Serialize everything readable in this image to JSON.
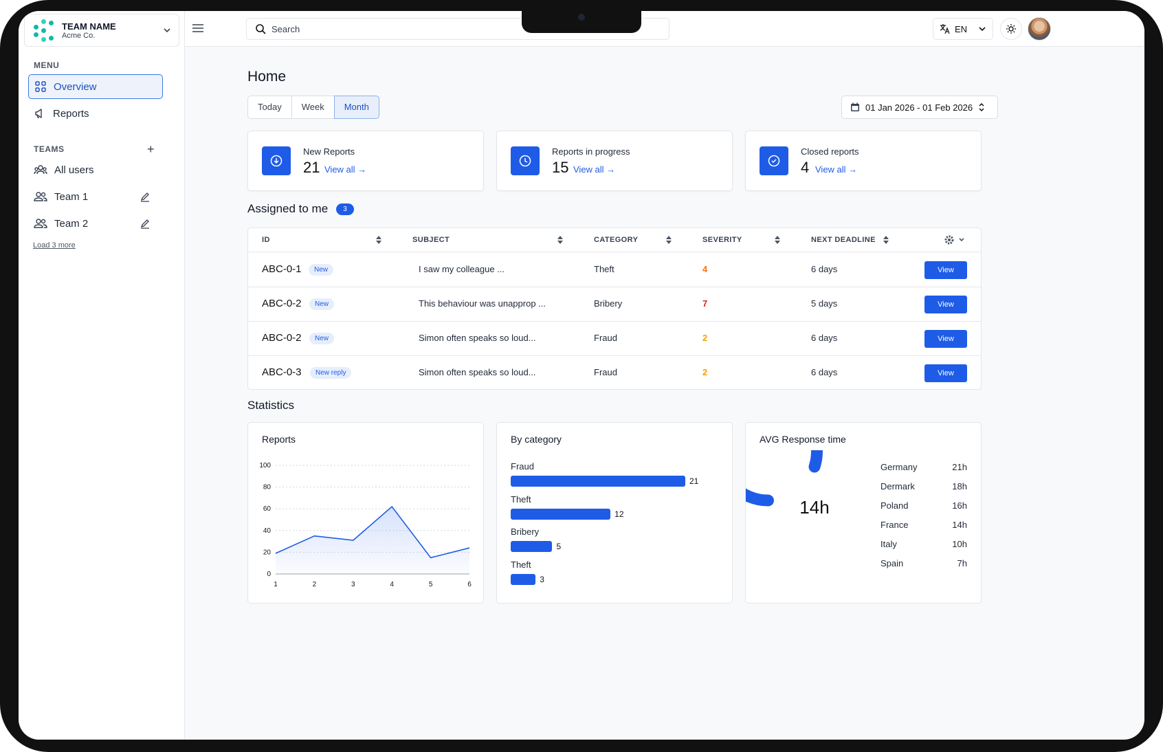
{
  "team": {
    "name": "TEAM NAME",
    "org": "Acme Co."
  },
  "sidebar": {
    "menu_label": "MENU",
    "menu_items": [
      {
        "label": "Overview",
        "icon": "grid-icon",
        "active": true
      },
      {
        "label": "Reports",
        "icon": "megaphone-icon",
        "active": false
      }
    ],
    "teams_label": "TEAMS",
    "team_items": [
      {
        "label": "All users"
      },
      {
        "label": "Team 1"
      },
      {
        "label": "Team 2"
      }
    ],
    "load_more": "Load 3 more"
  },
  "topbar": {
    "search_placeholder": "Search",
    "language": "EN"
  },
  "page": {
    "title": "Home",
    "periods": [
      "Today",
      "Week",
      "Month"
    ],
    "active_period": "Month",
    "date_range": "01 Jan 2026 - 01 Feb 2026"
  },
  "kpis": [
    {
      "label": "New Reports",
      "value": "21",
      "link": "View all →",
      "icon": "arrow-down-circle-icon"
    },
    {
      "label": "Reports in progress",
      "value": "15",
      "link": "View all →",
      "icon": "clock-icon"
    },
    {
      "label": "Closed reports",
      "value": "4",
      "link": "View all →",
      "icon": "check-circle-icon"
    }
  ],
  "assigned": {
    "title": "Assigned to me",
    "count": "3",
    "columns": [
      "ID",
      "SUBJECT",
      "CATEGORY",
      "SEVERITY",
      "NEXT DEADLINE"
    ],
    "view_label": "View",
    "rows": [
      {
        "id": "ABC-0-1",
        "tag": "New",
        "subject": "I saw my colleague ...",
        "category": "Theft",
        "severity": "4",
        "severity_color": "#f97316",
        "deadline": "6 days"
      },
      {
        "id": "ABC-0-2",
        "tag": "New",
        "subject": "This behaviour was unapprop ...",
        "category": "Bribery",
        "severity": "7",
        "severity_color": "#dc2626",
        "deadline": "5 days"
      },
      {
        "id": "ABC-0-2",
        "tag": "New",
        "subject": "Simon often speaks so loud...",
        "category": "Fraud",
        "severity": "2",
        "severity_color": "#f59e0b",
        "deadline": "6 days"
      },
      {
        "id": "ABC-0-3",
        "tag": "New reply",
        "subject": "Simon often speaks so loud...",
        "category": "Fraud",
        "severity": "2",
        "severity_color": "#f59e0b",
        "deadline": "6 days"
      }
    ]
  },
  "statistics": {
    "title": "Statistics",
    "reports_title": "Reports",
    "category_title": "By category",
    "avg_title": "AVG Response time",
    "avg_center": "14h",
    "avg_rows": [
      {
        "country": "Germany",
        "value": "21h"
      },
      {
        "country": "Dermark",
        "value": "18h"
      },
      {
        "country": "Poland",
        "value": "16h"
      },
      {
        "country": "France",
        "value": "14h"
      },
      {
        "country": "Italy",
        "value": "10h"
      },
      {
        "country": "Spain",
        "value": "7h"
      }
    ]
  },
  "chart_data": [
    {
      "type": "area",
      "title": "Reports",
      "x": [
        1,
        2,
        3,
        4,
        5,
        6
      ],
      "series": [
        {
          "values": [
            19,
            35,
            31,
            62,
            15,
            24
          ]
        }
      ],
      "ylim": [
        0,
        100
      ],
      "yticks": [
        0,
        20,
        40,
        60,
        80,
        100
      ],
      "grid": true,
      "color": "#1e5ce8"
    },
    {
      "type": "bar",
      "title": "By category",
      "orientation": "horizontal",
      "categories": [
        "Fraud",
        "Theft",
        "Bribery",
        "Theft"
      ],
      "values": [
        21,
        12,
        5,
        3
      ],
      "color": "#1e5ce8"
    },
    {
      "type": "pie",
      "title": "AVG Response time",
      "style": "donut",
      "center_label": "14h",
      "filled_fraction": 0.8,
      "color": "#1e5ce8"
    }
  ]
}
